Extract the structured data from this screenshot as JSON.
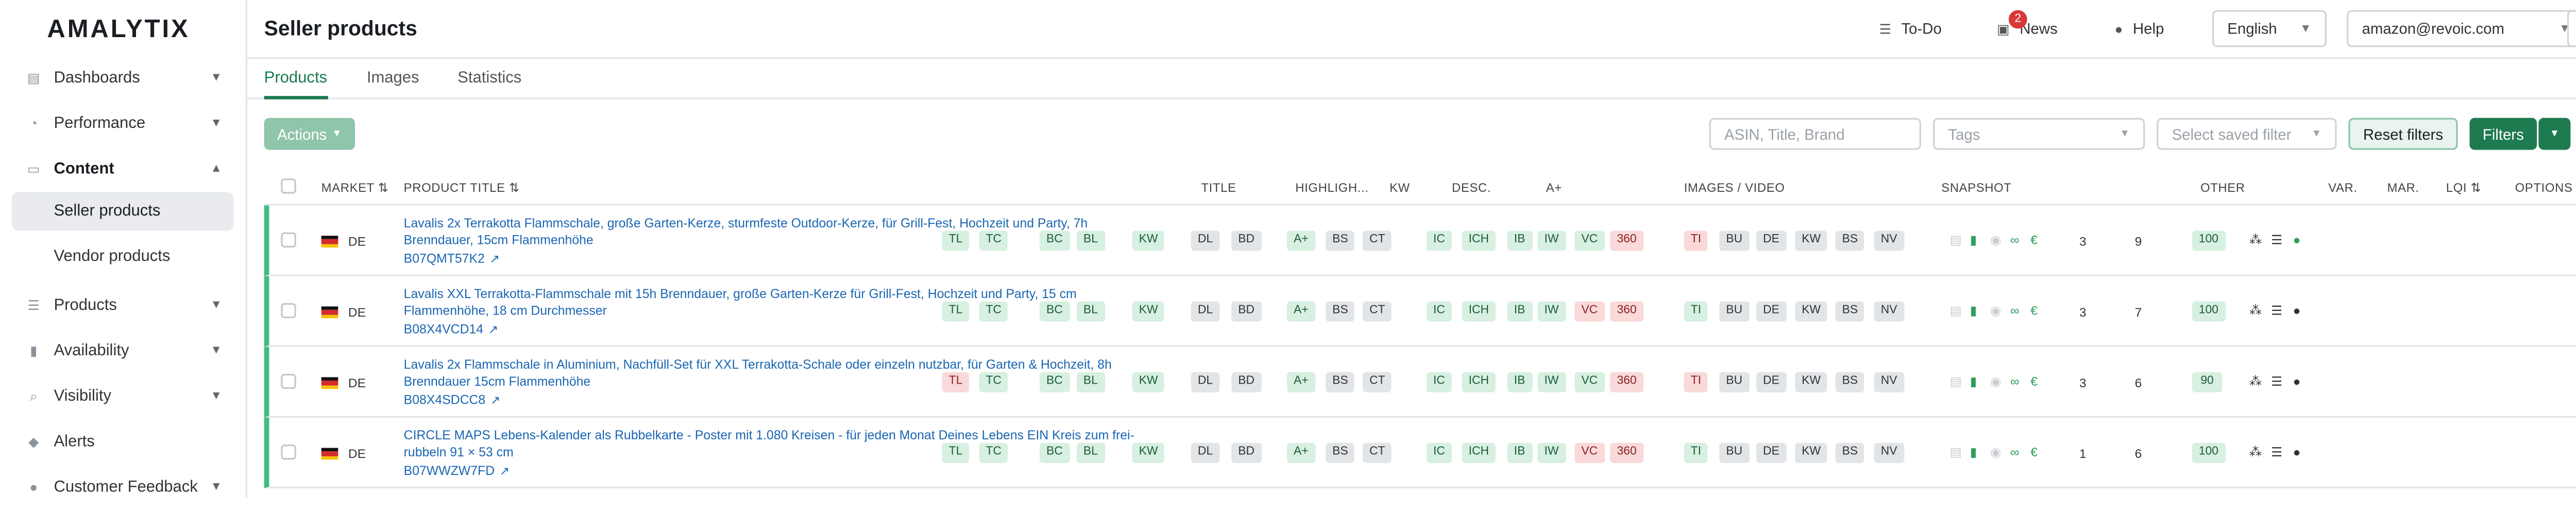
{
  "brand": "AMALYTIX",
  "sidebar": {
    "items": [
      {
        "label": "Dashboards",
        "icon": "dashboard-icon",
        "glyph": "▤"
      },
      {
        "label": "Performance",
        "icon": "gauge-icon",
        "glyph": "◔"
      },
      {
        "label": "Content",
        "icon": "content-icon",
        "glyph": "▭"
      },
      {
        "label": "Products",
        "icon": "list-icon",
        "glyph": "☰"
      },
      {
        "label": "Availability",
        "icon": "thermometer-icon",
        "glyph": "▮"
      },
      {
        "label": "Visibility",
        "icon": "search-icon",
        "glyph": "⌕"
      },
      {
        "label": "Alerts",
        "icon": "bell-icon",
        "glyph": "◆"
      },
      {
        "label": "Customer Feedback",
        "icon": "chat-icon",
        "glyph": "●"
      }
    ],
    "content_sub": [
      "Seller products",
      "Vendor products"
    ]
  },
  "header": {
    "title": "Seller products",
    "todo": "To-Do",
    "news": "News",
    "news_count": "2",
    "help": "Help",
    "language": "English",
    "account": "amazon@revoic.com"
  },
  "tabs": [
    "Products",
    "Images",
    "Statistics"
  ],
  "toolbar": {
    "actions": "Actions",
    "search_placeholder": "ASIN, Title, Brand",
    "tags_placeholder": "Tags",
    "saved_filter_placeholder": "Select saved filter",
    "reset": "Reset filters",
    "filters": "Filters"
  },
  "columns": [
    "MARKET",
    "PRODUCT TITLE",
    "TITLE",
    "HIGHLIGH...",
    "KW",
    "DESC.",
    "A+",
    "IMAGES / VIDEO",
    "SNAPSHOT",
    "OTHER",
    "VAR.",
    "MAR.",
    "LQI",
    "OPTIONS"
  ],
  "rows": [
    {
      "market": "DE",
      "title": "Lavalis 2x Terrakotta Flammschale, große Garten-Kerze, sturmfeste Outdoor-Kerze, für Grill-Fest, Hochzeit und Party, 7h Brenndauer, 15cm Flammenhöhe",
      "asin": "B07QMT57K2",
      "tl_status": "g",
      "vc_status": "g",
      "ti_status": "r",
      "var": "3",
      "mar": "9",
      "lqi": "100"
    },
    {
      "market": "DE",
      "title": "Lavalis XXL Terrakotta-Flammschale mit 15h Brenndauer, große Garten-Kerze für Grill-Fest, Hochzeit und Party, 15 cm Flammenhöhe, 18 cm Durchmesser",
      "asin": "B08X4VCD14",
      "tl_status": "g",
      "vc_status": "r",
      "ti_status": "g",
      "var": "3",
      "mar": "7",
      "lqi": "100"
    },
    {
      "market": "DE",
      "title": "Lavalis 2x Flammschale in Aluminium, Nachfüll-Set für XXL Terrakotta-Schale oder einzeln nutzbar, für Garten & Hochzeit, 8h Brenndauer 15cm Flammenhöhe",
      "asin": "B08X4SDCC8",
      "tl_status": "r",
      "vc_status": "g",
      "ti_status": "r",
      "var": "3",
      "mar": "6",
      "lqi": "90"
    },
    {
      "market": "DE",
      "title": "CIRCLE MAPS Lebens-Kalender als Rubbelkarte - Poster mit 1.080 Kreisen - für jeden Monat Deines Lebens EIN Kreis zum frei-rubbeln 91 × 53 cm",
      "asin": "B07WWZW7FD",
      "tl_status": "g",
      "vc_status": "r",
      "ti_status": "g",
      "var": "1",
      "mar": "6",
      "lqi": "100"
    }
  ],
  "tags": {
    "title": [
      "TL",
      "TC"
    ],
    "highlights": [
      "BC",
      "BL"
    ],
    "kw": [
      "KW"
    ],
    "desc": [
      "DL",
      "BD"
    ],
    "aplus": [
      "A+",
      "BS",
      "CT"
    ],
    "images": [
      "IC",
      "ICH",
      "IB",
      "IW",
      "VC",
      "360"
    ],
    "snapshot": [
      "TI",
      "BU",
      "DE",
      "KW",
      "BS",
      "NV"
    ]
  },
  "colors": {
    "accent": "#1e7a4f",
    "ok": "#d7f0e1",
    "bad": "#f9d9d9",
    "link": "#1a66b2"
  }
}
